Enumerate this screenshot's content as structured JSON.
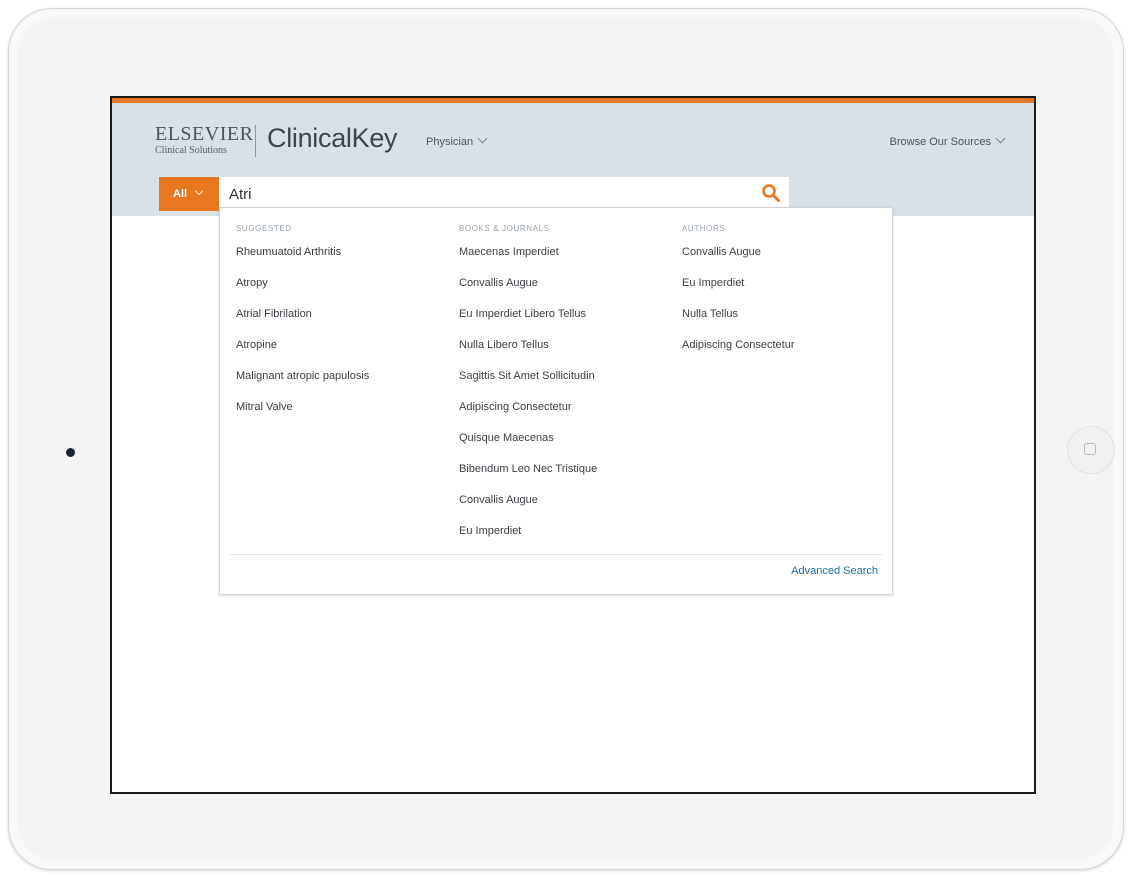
{
  "header": {
    "brand": "ELSEVIER",
    "brand_sub": "Clinical Solutions",
    "product": "ClinicalKey",
    "role_menu": "Physician",
    "browse_menu": "Browse Our Sources"
  },
  "search": {
    "scope": "All",
    "query": "Atri",
    "icon": "search-icon",
    "accent_color": "#e87722"
  },
  "dropdown": {
    "suggested": {
      "heading": "SUGGESTED",
      "items": [
        "Rheumuatoid Arthritis",
        "Atropy",
        "Atrial Fibrilation",
        "Atropine",
        "Malignant atropic papulosis",
        "Mitral Valve"
      ]
    },
    "books": {
      "heading": "BOOKS & JOURNALS",
      "items": [
        "Maecenas Imperdiet",
        "Convallis Augue",
        "Eu Imperdiet Libero Tellus",
        "Nulla Libero Tellus",
        "Sagittis Sit Amet Sollicitudin",
        "Adipiscing Consectetur",
        "Quisque Maecenas",
        "Bibendum Leo Nec Tristique",
        "Convallis Augue",
        "Eu Imperdiet"
      ]
    },
    "authors": {
      "heading": "AUTHORS",
      "items": [
        "Convallis Augue",
        "Eu Imperdiet",
        "Nulla Tellus",
        "Adipiscing Consectetur"
      ]
    },
    "advanced_search": "Advanced Search"
  }
}
